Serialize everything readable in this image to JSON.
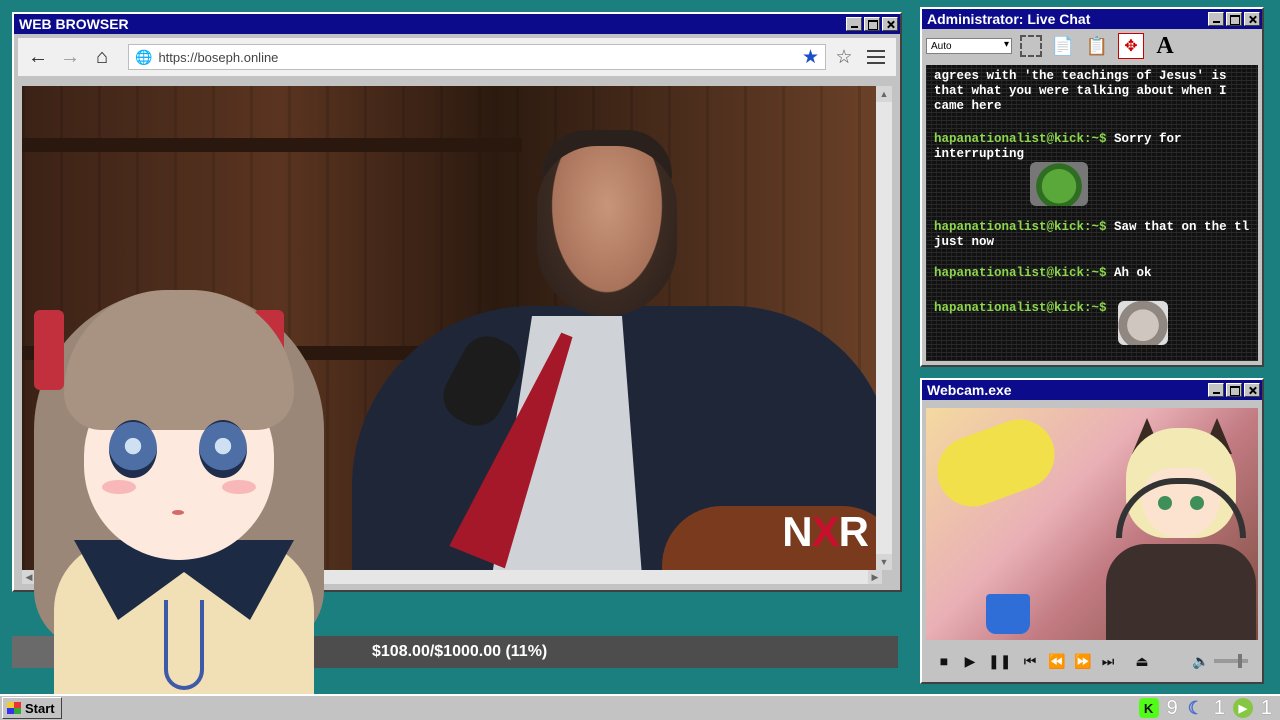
{
  "browser": {
    "title": "WEB BROWSER",
    "url": "https://boseph.online",
    "video_watermark": "NR",
    "video_watermark_x": "X"
  },
  "donation": {
    "label": "$108.00/$1000.00 (11%)",
    "progress_fraction": 0.108
  },
  "chat": {
    "title": "Administrator: Live Chat",
    "font_select": "Auto",
    "messages": [
      {
        "user": "",
        "text": "agrees with 'the teachings of Jesus' is that what you were talking about when I came here"
      },
      {
        "user": "hapanationalist@kick:~$",
        "text": "Sorry for interrupting",
        "emote": "pepe"
      },
      {
        "user": "hapanationalist@kick:~$",
        "text": "Saw that on the tl just now"
      },
      {
        "user": "hapanationalist@kick:~$",
        "text": "Ah ok"
      },
      {
        "user": "hapanationalist@kick:~$",
        "text": "",
        "emote": "cat"
      }
    ]
  },
  "webcam": {
    "title": "Webcam.exe"
  },
  "taskbar": {
    "start_label": "Start",
    "tray": [
      {
        "icon": "kick-icon",
        "count": "9"
      },
      {
        "icon": "moon-icon",
        "count": "1"
      },
      {
        "icon": "rumble-icon",
        "count": "1"
      }
    ]
  }
}
